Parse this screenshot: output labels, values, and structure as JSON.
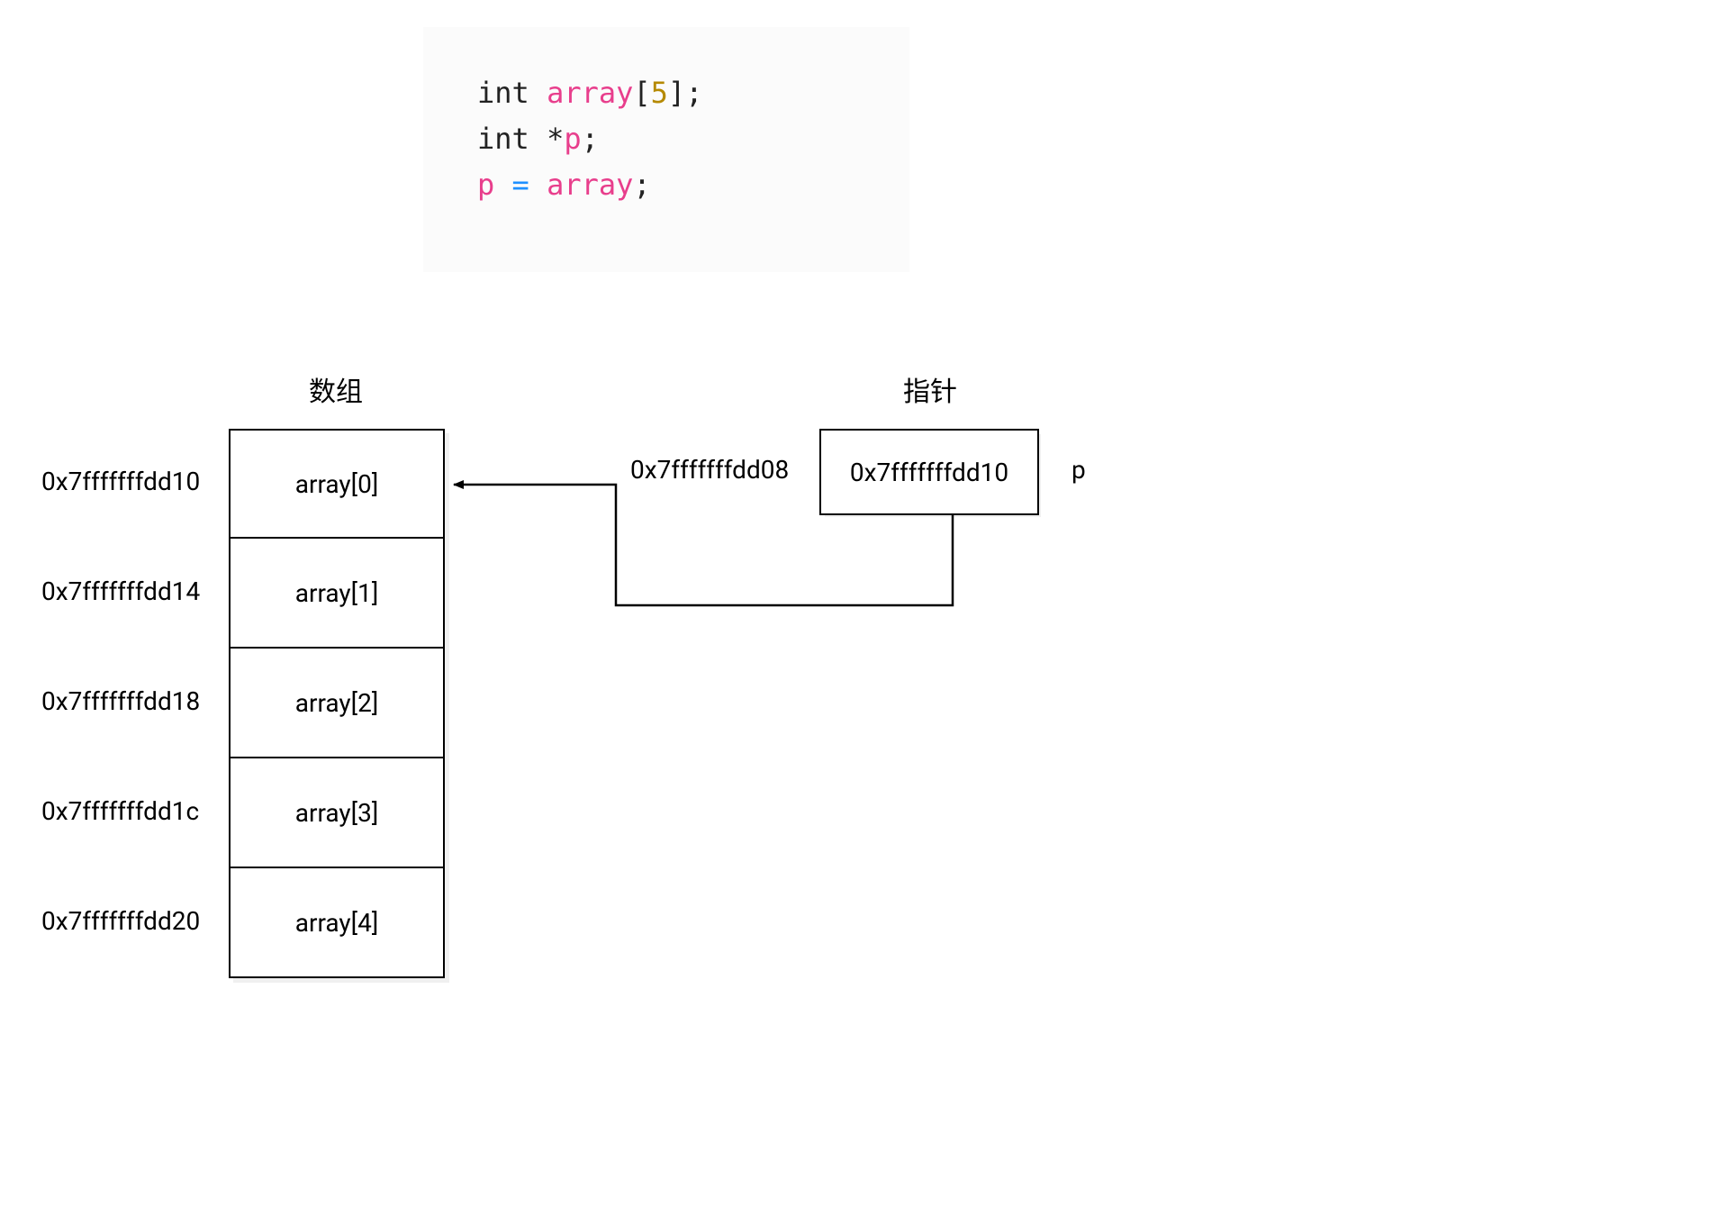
{
  "code": {
    "line1": {
      "kw": "int ",
      "name": "array",
      "lb": "[",
      "num": "5",
      "rb": "];"
    },
    "line2": {
      "kw": "int ",
      "star": "*",
      "name": "p",
      "semi": ";"
    },
    "line3": {
      "p": "p",
      "sp1": " ",
      "eq": "=",
      "sp2": " ",
      "arr": "array",
      "semi": ";"
    }
  },
  "titles": {
    "array": "数组",
    "pointer": "指针"
  },
  "array_cells": [
    {
      "addr": "0x7fffffffdd10",
      "label": "array[0]"
    },
    {
      "addr": "0x7fffffffdd14",
      "label": "array[1]"
    },
    {
      "addr": "0x7fffffffdd18",
      "label": "array[2]"
    },
    {
      "addr": "0x7fffffffdd1c",
      "label": "array[3]"
    },
    {
      "addr": "0x7fffffffdd20",
      "label": "array[4]"
    }
  ],
  "pointer": {
    "addr": "0x7fffffffdd08",
    "value": "0x7fffffffdd10",
    "name": "p"
  }
}
